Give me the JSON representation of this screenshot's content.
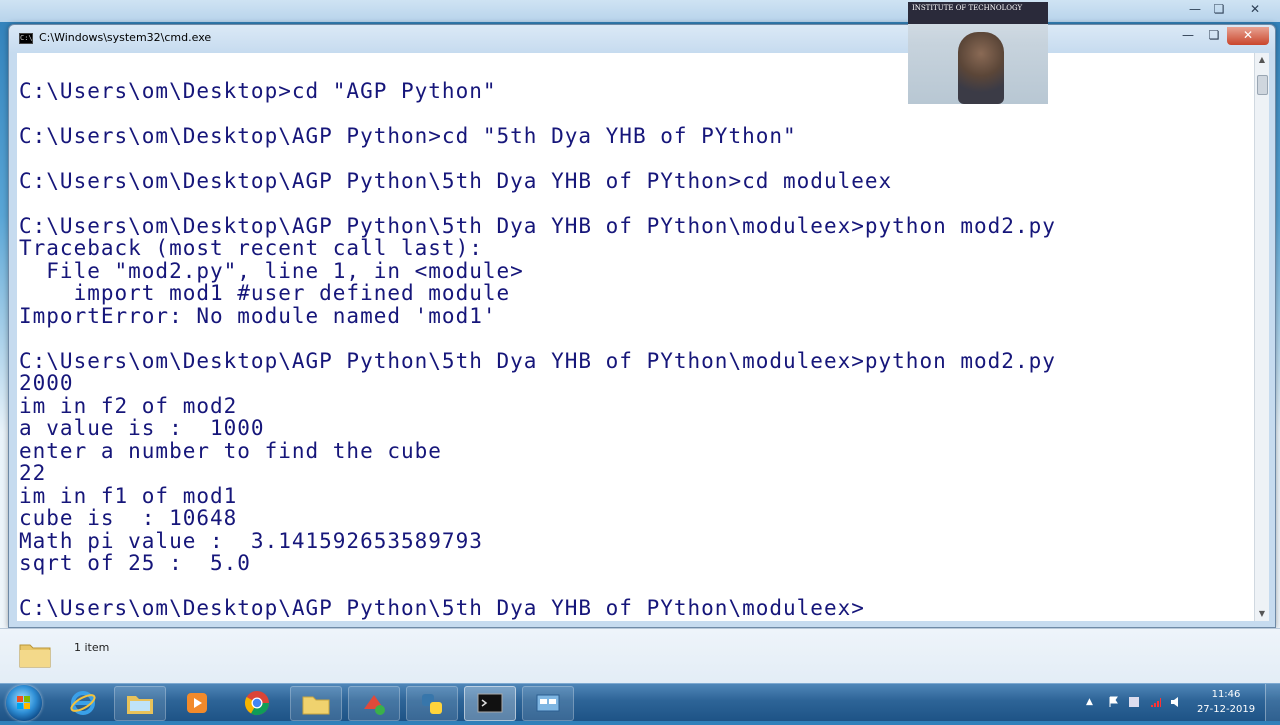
{
  "window": {
    "title": "C:\\Windows\\system32\\cmd.exe",
    "icon_label": "C:\\"
  },
  "console": {
    "lines": [
      "",
      "C:\\Users\\om\\Desktop>cd \"AGP Python\"",
      "",
      "C:\\Users\\om\\Desktop\\AGP Python>cd \"5th Dya YHB of PYthon\"",
      "",
      "C:\\Users\\om\\Desktop\\AGP Python\\5th Dya YHB of PYthon>cd moduleex",
      "",
      "C:\\Users\\om\\Desktop\\AGP Python\\5th Dya YHB of PYthon\\moduleex>python mod2.py",
      "Traceback (most recent call last):",
      "  File \"mod2.py\", line 1, in <module>",
      "    import mod1 #user defined module",
      "ImportError: No module named 'mod1'",
      "",
      "C:\\Users\\om\\Desktop\\AGP Python\\5th Dya YHB of PYthon\\moduleex>python mod2.py",
      "2000",
      "im in f2 of mod2",
      "a value is :  1000",
      "enter a number to find the cube",
      "22",
      "im in f1 of mod1",
      "cube is  : 10648",
      "Math pi value :  3.141592653589793",
      "sqrt of 25 :  5.0",
      "",
      "C:\\Users\\om\\Desktop\\AGP Python\\5th Dya YHB of PYthon\\moduleex>"
    ]
  },
  "webcam": {
    "sign_text": "INSTITUTE OF TECHNOLOGY"
  },
  "explorer": {
    "items_count": "1 item"
  },
  "taskbar": {
    "clock_time": "11:46",
    "clock_date": "27-12-2019"
  },
  "colors": {
    "console_text": "#16167a",
    "taskbar": "#2d6497"
  }
}
